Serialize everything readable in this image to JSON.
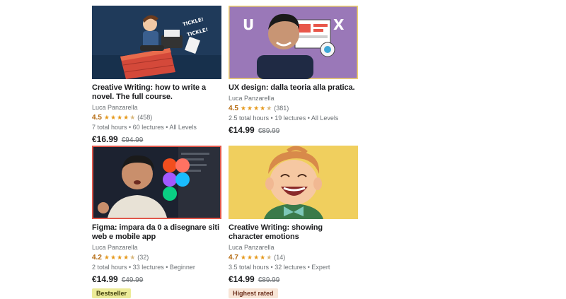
{
  "courses": [
    {
      "title": "Creative Writing: how to write a novel. The full course.",
      "author": "Luca Panzarella",
      "rating": "4.5",
      "stars": 4.5,
      "reviews": "(458)",
      "meta": "7 total hours • 60 lectures • All Levels",
      "price": "€16.99",
      "old_price": "€94.99",
      "thumb_text": [
        "TICKLE!",
        "TICKLE!"
      ],
      "badge": ""
    },
    {
      "title": "UX design: dalla teoria alla pratica.",
      "author": "Luca Panzarella",
      "rating": "4.5",
      "stars": 4.5,
      "reviews": "(381)",
      "meta": "2.5 total hours • 19 lectures • All Levels",
      "price": "€14.99",
      "old_price": "€89.99",
      "thumb_text": [
        "U",
        "X"
      ],
      "badge": ""
    },
    {
      "title": "Figma: impara da 0 a disegnare siti web e mobile app",
      "author": "Luca Panzarella",
      "rating": "4.2",
      "stars": 4.2,
      "reviews": "(32)",
      "meta": "2 total hours • 33 lectures • Beginner",
      "price": "€14.99",
      "old_price": "€49.99",
      "badge": "Bestseller"
    },
    {
      "title": "Creative Writing: showing character emotions",
      "author": "Luca Panzarella",
      "rating": "4.7",
      "stars": 4.7,
      "reviews": "(14)",
      "meta": "3.5 total hours • 32 lectures • Expert",
      "price": "€14.99",
      "old_price": "€89.99",
      "badge": "Highest rated"
    }
  ],
  "colors": {
    "rating": "#b4690e",
    "star": "#e59819",
    "bestseller_bg": "#eceb98",
    "highest_rated_bg": "#f8e5d6"
  }
}
